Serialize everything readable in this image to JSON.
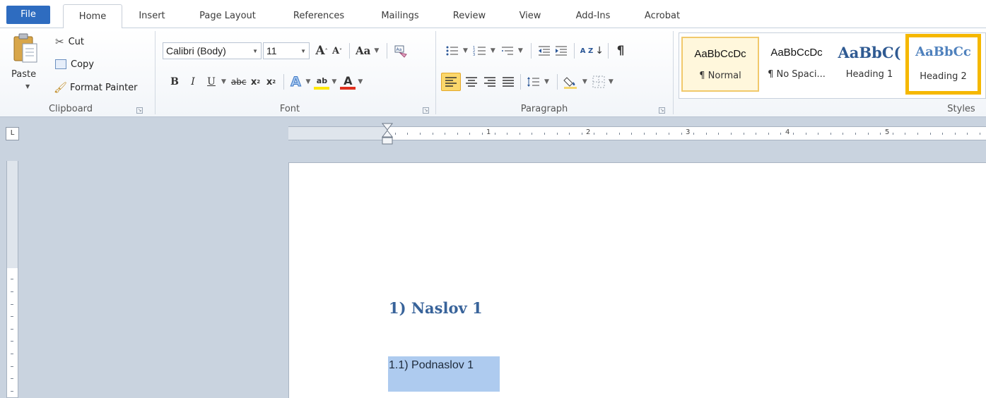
{
  "tabs": {
    "file": "File",
    "home": "Home",
    "insert": "Insert",
    "page_layout": "Page Layout",
    "references": "References",
    "mailings": "Mailings",
    "review": "Review",
    "view": "View",
    "add_ins": "Add-Ins",
    "acrobat": "Acrobat"
  },
  "clipboard": {
    "paste": "Paste",
    "cut": "Cut",
    "copy": "Copy",
    "format_painter": "Format Painter",
    "group_label": "Clipboard"
  },
  "font": {
    "font_name": "Calibri (Body)",
    "font_size": "11",
    "grow": "A",
    "shrink": "A",
    "change_case": "Aa",
    "bold": "B",
    "italic": "I",
    "underline": "U",
    "strikethrough": "abc",
    "subscript": "x",
    "superscript": "x",
    "text_effects": "A",
    "highlight": "ab",
    "font_color": "A",
    "group_label": "Font"
  },
  "paragraph": {
    "sort": "A Z",
    "show_marks": "¶",
    "group_label": "Paragraph"
  },
  "styles": {
    "items": [
      {
        "preview": "AaBbCcDc",
        "name": "¶ Normal"
      },
      {
        "preview": "AaBbCcDc",
        "name": "¶ No Spaci..."
      },
      {
        "preview": "AaBbC(",
        "name": "Heading 1"
      },
      {
        "preview": "AaBbCc",
        "name": "Heading 2"
      }
    ],
    "group_label": "Styles"
  },
  "ruler": {
    "tab_selector": "L",
    "numbers": [
      "1",
      "1",
      "2",
      "3",
      "4",
      "5"
    ]
  },
  "document": {
    "heading1": "1) Naslov 1",
    "heading2": "1.1) Podnaslov 1"
  },
  "colors": {
    "file_tab": "#2e6cc0",
    "heading_text": "#38639a",
    "selection": "#aecbef",
    "active_style_border": "#f5b800"
  }
}
